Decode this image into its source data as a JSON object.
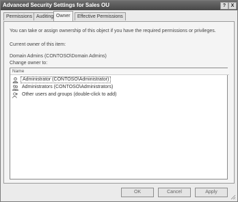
{
  "window": {
    "title": "Advanced Security Settings for Sales OU",
    "help_glyph": "?",
    "close_glyph": "X"
  },
  "tabs": [
    {
      "label": "Permissions"
    },
    {
      "label": "Auditing"
    },
    {
      "label": "Owner",
      "active": true
    },
    {
      "label": "Effective Permissions"
    }
  ],
  "owner_tab": {
    "description": "You can take or assign ownership of this object if you have the required permissions or privileges.",
    "current_owner_label": "Current owner of this item:",
    "current_owner_value": "Domain Admins (CONTOSO\\Domain Admins)",
    "change_owner_label": "Change owner to:",
    "list_header": "Name",
    "items": [
      {
        "label": "Administrator (CONTOSO\\Administrator)",
        "icon": "user-icon",
        "selected": true
      },
      {
        "label": "Administrators (CONTOSO\\Administrators)",
        "icon": "group-icon"
      },
      {
        "label": "Other users and groups (double-click to add)",
        "icon": "add-users-icon"
      }
    ]
  },
  "buttons": {
    "ok": "OK",
    "cancel": "Cancel",
    "apply": "Apply"
  }
}
